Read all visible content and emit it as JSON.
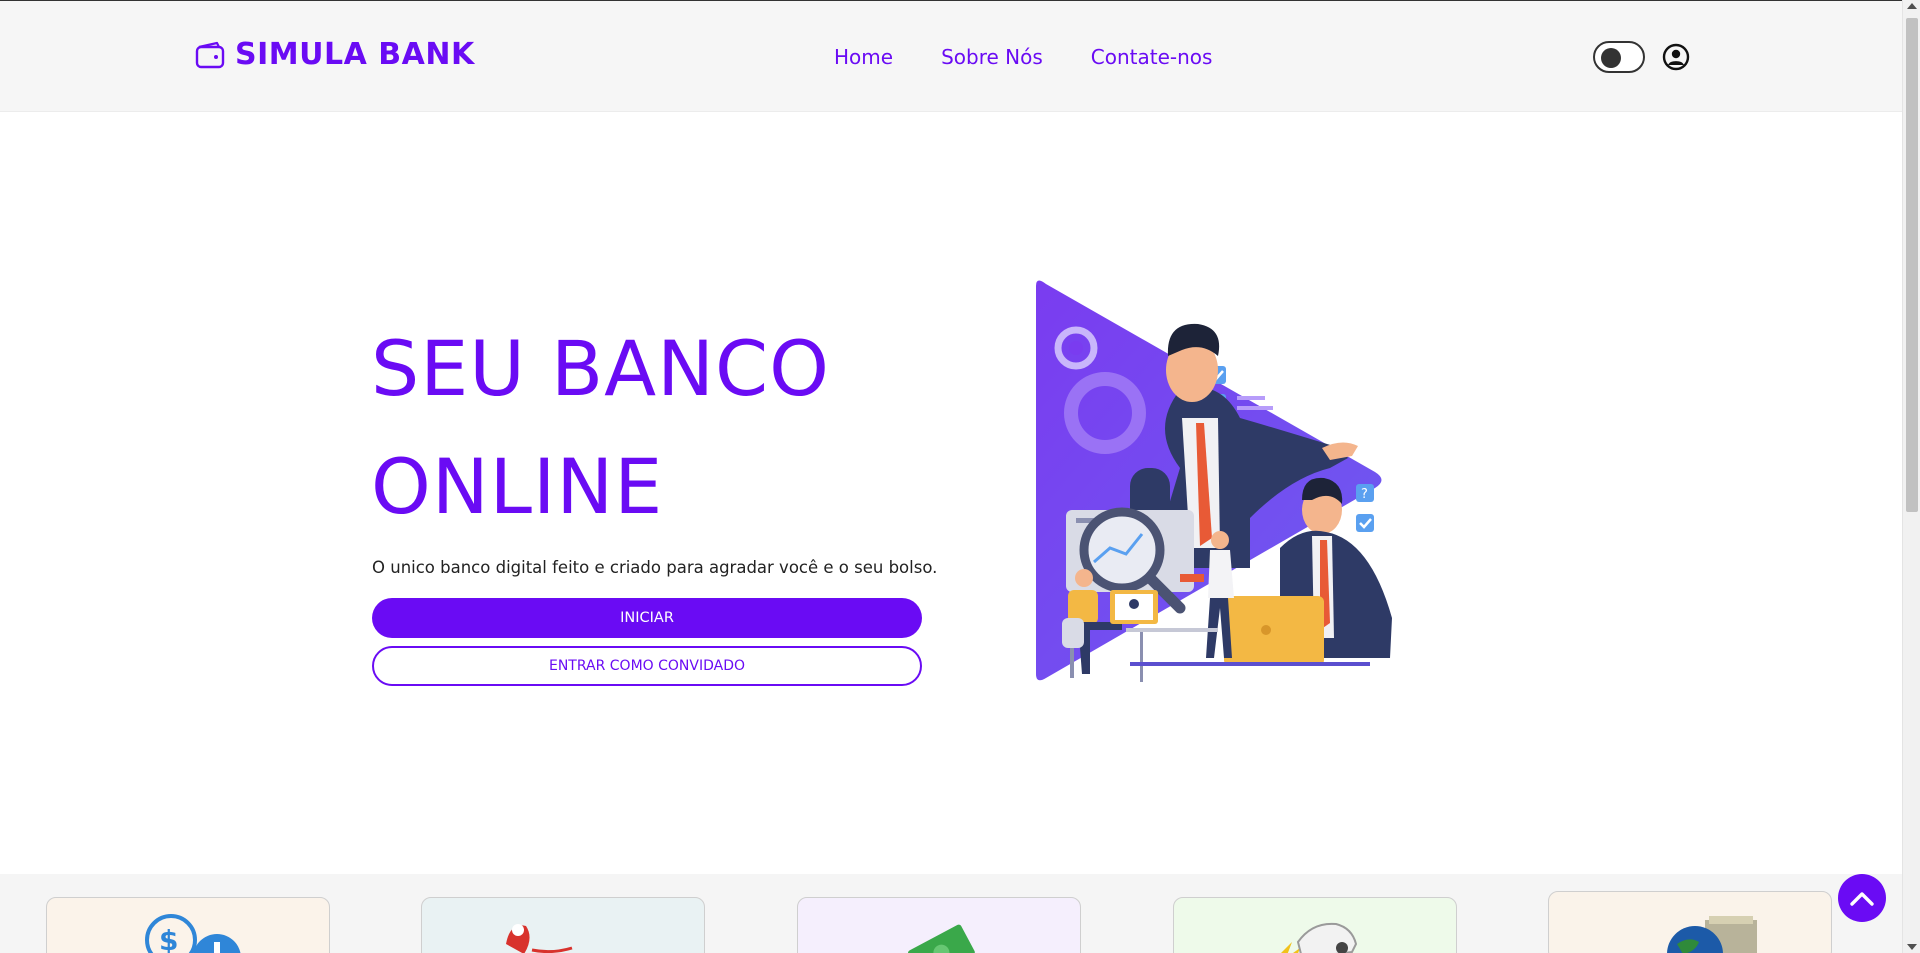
{
  "header": {
    "brand": "SIMULA BANK",
    "nav": [
      "Home",
      "Sobre Nós",
      "Contate-nos"
    ],
    "theme_toggle_icon": "toggle-icon",
    "user_icon": "user-circle-icon"
  },
  "hero": {
    "title_line1": "SEU BANCO",
    "title_line2": "ONLINE",
    "subtitle": "O unico banco digital feito e criado para agradar você e o seu bolso.",
    "primary_button": "INICIAR",
    "secondary_button": "ENTRAR COMO CONVIDADO"
  },
  "services": {
    "cards": [
      {
        "icon": "dollar-coins-icon",
        "bg": "#fbf3ea"
      },
      {
        "icon": "gift-icon",
        "bg": "#e9f2f3"
      },
      {
        "icon": "cash-icon",
        "bg": "#f5effd"
      },
      {
        "icon": "car-crash-icon",
        "bg": "#eefaea"
      },
      {
        "icon": "globe-money-icon",
        "bg": "#faf3ea"
      }
    ]
  },
  "scroll_top_icon": "chevron-up-icon",
  "colors": {
    "accent": "#6a0bf4",
    "header_bg": "#f6f6f6"
  }
}
